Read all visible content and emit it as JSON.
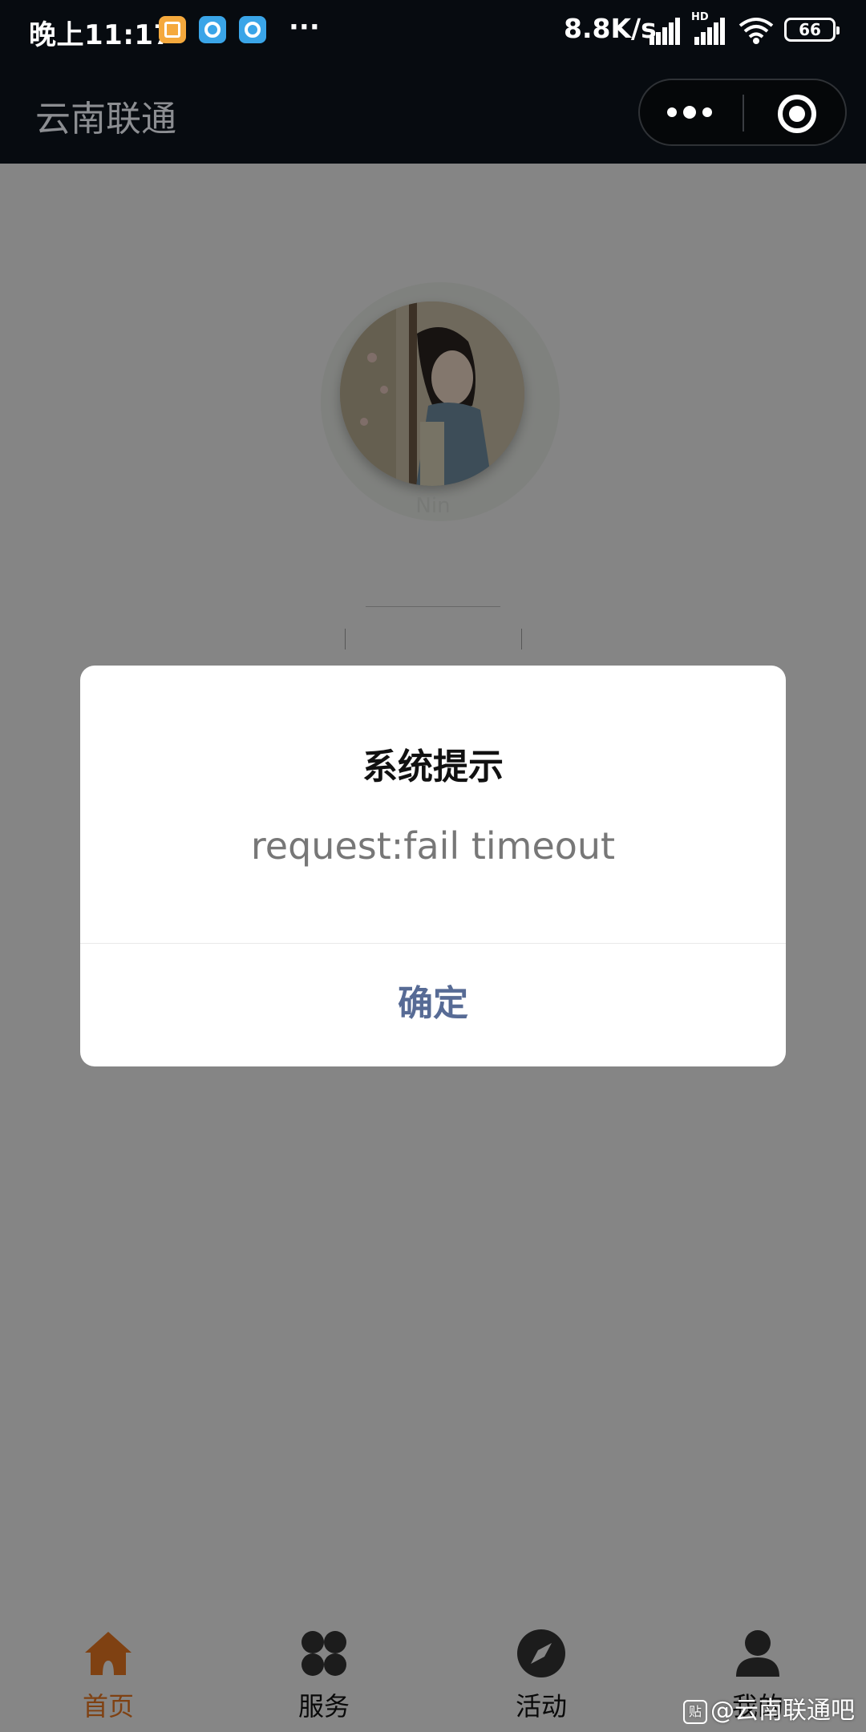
{
  "status_bar": {
    "time": "晚上11:17",
    "more": "···",
    "net_speed": "8.8K/s",
    "hd": "HD",
    "battery": "66"
  },
  "nav": {
    "title": "云南联通"
  },
  "profile": {
    "avatar_name": "Nin"
  },
  "dialog": {
    "title": "系统提示",
    "message": "request:fail timeout",
    "confirm": "确定"
  },
  "tabs": [
    {
      "label": "首页",
      "icon": "home-icon",
      "active": true
    },
    {
      "label": "服务",
      "icon": "grid-icon",
      "active": false
    },
    {
      "label": "活动",
      "icon": "compass-icon",
      "active": false
    },
    {
      "label": "我的",
      "icon": "person-icon",
      "active": false
    }
  ],
  "watermark": {
    "logo": "贴",
    "text": "@云南联通吧"
  },
  "colors": {
    "active_tab": "#e87722",
    "dialog_button": "#576b95",
    "topbar": "#070b10"
  }
}
